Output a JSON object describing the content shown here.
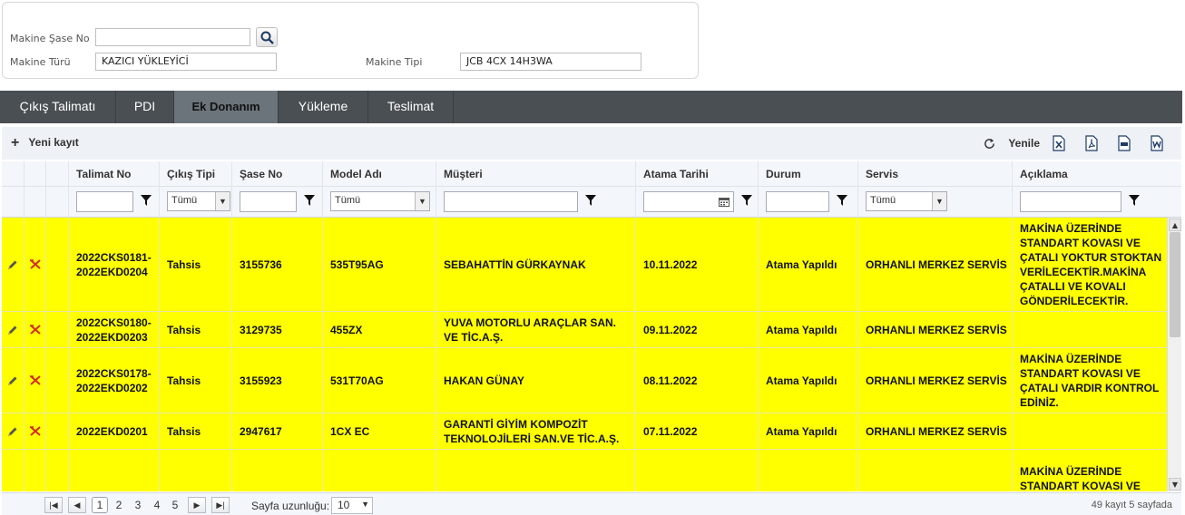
{
  "filter_panel": {
    "chassis_label": "Makine Şase No",
    "chassis_value": "",
    "machine_type_label": "Makine Türü",
    "machine_type_value": "KAZICI YÜKLEYİCİ",
    "machine_model_label": "Makine Tipi",
    "machine_model_value": "JCB 4CX 14H3WA"
  },
  "tabs": [
    {
      "label": "Çıkış Talimatı",
      "active": false
    },
    {
      "label": "PDI",
      "active": false
    },
    {
      "label": "Ek Donanım",
      "active": true
    },
    {
      "label": "Yükleme",
      "active": false
    },
    {
      "label": "Teslimat",
      "active": false
    }
  ],
  "toolbar": {
    "add_label": "Yeni kayıt",
    "refresh_label": "Yenile",
    "export_icons": [
      "excel-icon",
      "pdf-icon",
      "csv-icon",
      "word-icon"
    ]
  },
  "columns": [
    {
      "key": "talimat_no",
      "label": "Talimat No",
      "filter": "text"
    },
    {
      "key": "cikis_tipi",
      "label": "Çıkış Tipi",
      "filter": "select",
      "filter_value": "Tümü"
    },
    {
      "key": "sase_no",
      "label": "Şase No",
      "filter": "text"
    },
    {
      "key": "model_adi",
      "label": "Model Adı",
      "filter": "select",
      "filter_value": "Tümü"
    },
    {
      "key": "musteri",
      "label": "Müşteri",
      "filter": "text"
    },
    {
      "key": "atama_tarihi",
      "label": "Atama Tarihi",
      "filter": "date"
    },
    {
      "key": "durum",
      "label": "Durum",
      "filter": "text"
    },
    {
      "key": "servis",
      "label": "Servis",
      "filter": "select",
      "filter_value": "Tümü"
    },
    {
      "key": "aciklama",
      "label": "Açıklama",
      "filter": "text"
    }
  ],
  "rows": [
    {
      "talimat_no": "2022CKS0181-2022EKD0204",
      "cikis_tipi": "Tahsis",
      "sase_no": "3155736",
      "model_adi": "535T95AG",
      "musteri": "SEBAHATTİN GÜRKAYNAK",
      "atama_tarihi": "10.11.2022",
      "durum": "Atama Yapıldı",
      "servis": "ORHANLI MERKEZ SERVİS",
      "aciklama": "MAKİNA ÜZERİNDE STANDART KOVASI VE ÇATALI YOKTUR STOKTAN VERİLECEKTİR.MAKİNA ÇATALLI VE KOVALI GÖNDERİLECEKTİR."
    },
    {
      "talimat_no": "2022CKS0180-2022EKD0203",
      "cikis_tipi": "Tahsis",
      "sase_no": "3129735",
      "model_adi": "455ZX",
      "musteri": "YUVA MOTORLU ARAÇLAR SAN. VE TİC.A.Ş.",
      "atama_tarihi": "09.11.2022",
      "durum": "Atama Yapıldı",
      "servis": "ORHANLI MERKEZ SERVİS",
      "aciklama": ""
    },
    {
      "talimat_no": "2022CKS0178-2022EKD0202",
      "cikis_tipi": "Tahsis",
      "sase_no": "3155923",
      "model_adi": "531T70AG",
      "musteri": "HAKAN GÜNAY",
      "atama_tarihi": "08.11.2022",
      "durum": "Atama Yapıldı",
      "servis": "ORHANLI MERKEZ SERVİS",
      "aciklama": "MAKİNA ÜZERİNDE STANDART KOVASI VE ÇATALI VARDIR KONTROL EDİNİZ."
    },
    {
      "talimat_no": "2022EKD0201",
      "cikis_tipi": "Tahsis",
      "sase_no": "2947617",
      "model_adi": "1CX EC",
      "musteri": "GARANTİ GİYİM KOMPOZİT TEKNOLOJİLERİ SAN.VE TİC.A.Ş.",
      "atama_tarihi": "07.11.2022",
      "durum": "Atama Yapıldı",
      "servis": "ORHANLI MERKEZ SERVİS",
      "aciklama": ""
    },
    {
      "talimat_no": "",
      "cikis_tipi": "",
      "sase_no": "",
      "model_adi": "",
      "musteri": "",
      "atama_tarihi": "",
      "durum": "",
      "servis": "",
      "aciklama": "MAKİNA ÜZERİNDE STANDART KOVASI VE ÇATALI YOKTUR STOKTAN"
    }
  ],
  "row_highlight_color": "#ffff00",
  "pager": {
    "pages": [
      "1",
      "2",
      "3",
      "4",
      "5"
    ],
    "current_page": "1",
    "page_size_label": "Sayfa uzunluğu:",
    "page_size_value": "10",
    "info": "49 kayıt 5 sayfada"
  }
}
